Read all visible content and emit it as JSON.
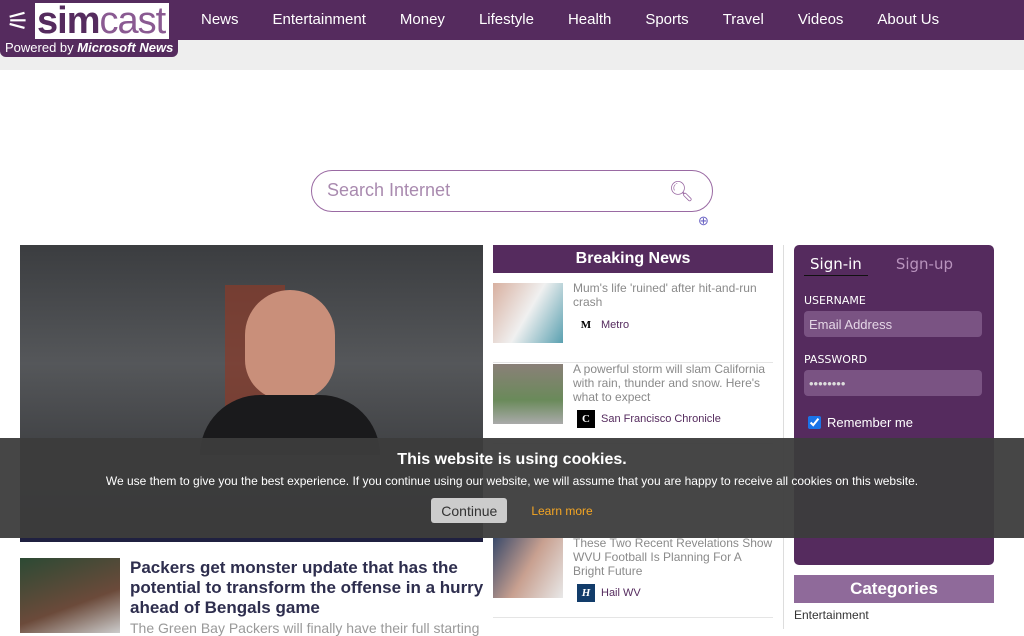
{
  "brand": {
    "name_bold": "sim",
    "name_light": "cast",
    "powered_prefix": "Powered by ",
    "powered_by": "Microsoft News"
  },
  "nav": [
    "News",
    "Entertainment",
    "Money",
    "Lifestyle",
    "Health",
    "Sports",
    "Travel",
    "Videos",
    "About Us"
  ],
  "search": {
    "placeholder": "Search Internet"
  },
  "main_story": {
    "title": "Packers get monster update that has the potential to transform the offense in a hurry ahead of Bengals game",
    "summary": "The Green Bay Packers will finally have their full starting"
  },
  "breaking": {
    "title": "Breaking News",
    "items": [
      {
        "title": "Mum's life 'ruined' after hit-and-run crash",
        "source": "Metro",
        "source_icon": "M"
      },
      {
        "title": "A powerful storm will slam California with rain, thunder and snow. Here's what to expect",
        "source": "San Francisco Chronicle",
        "source_icon": "C"
      },
      {
        "title": "These Two Recent Revelations Show WVU Football Is Planning For A Bright Future",
        "source": "Hail WV",
        "source_icon": "H"
      }
    ]
  },
  "signin": {
    "tab_signin": "Sign-in",
    "tab_signup": "Sign-up",
    "username_label": "USERNAME",
    "username_placeholder": "Email Address",
    "password_label": "PASSWORD",
    "password_value": "********",
    "remember": "Remember me"
  },
  "categories": {
    "title": "Categories",
    "items": [
      "Entertainment"
    ]
  },
  "cookie": {
    "title": "This website is using cookies.",
    "text": "We use them to give you the best experience. If you continue using our website, we will assume that you are happy to receive all cookies on this website.",
    "continue": "Continue",
    "learn": "Learn more"
  }
}
